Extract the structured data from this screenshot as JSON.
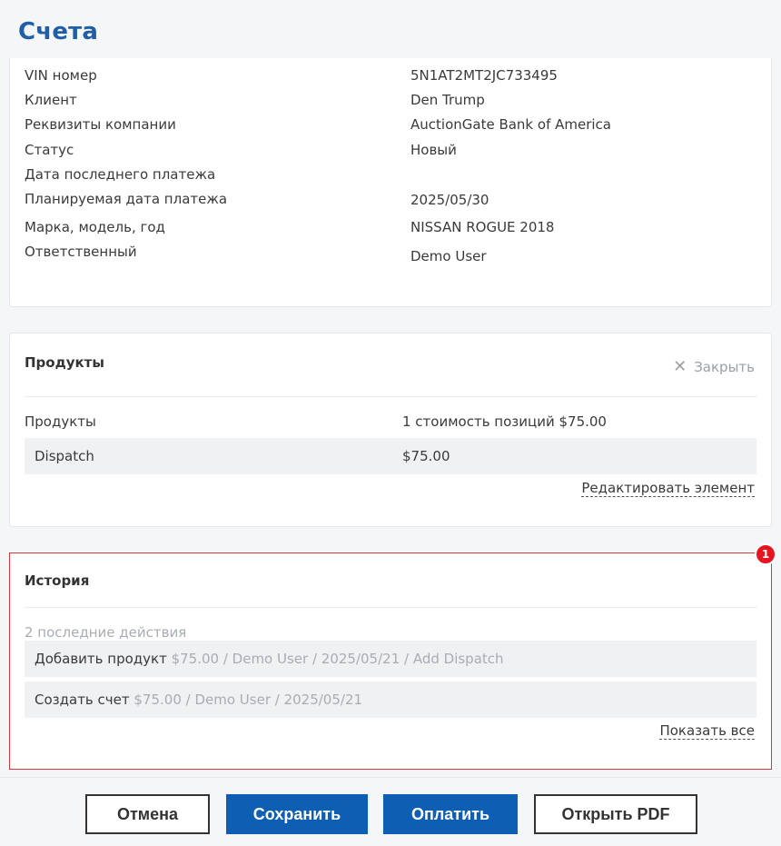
{
  "page": {
    "title": "Счета"
  },
  "details": {
    "rows": [
      {
        "label": "VIN номер",
        "value": "5N1AT2MT2JC733495"
      },
      {
        "label": "Клиент",
        "value": "Den Trump"
      },
      {
        "label": "Реквизиты компании",
        "value": "AuctionGate Bank of America"
      },
      {
        "label": "Статус",
        "value": "Новый"
      },
      {
        "label": "Дата последнего платежа",
        "value": ""
      },
      {
        "label": "Планируемая дата платежа",
        "value": "2025/05/30"
      },
      {
        "label": "Марка, модель, год",
        "value": "NISSAN ROGUE 2018"
      },
      {
        "label": "Ответственный",
        "value": "Demo User"
      }
    ]
  },
  "products": {
    "title": "Продукты",
    "close_label": "Закрыть",
    "summary": {
      "label": "Продукты",
      "value": "1 стоимость позиций $75.00"
    },
    "items": [
      {
        "name": "Dispatch",
        "price": "$75.00"
      }
    ],
    "edit_link": "Редактировать элемент"
  },
  "history": {
    "badge": "1",
    "title": "История",
    "count_text": "2 последние действия",
    "items": [
      {
        "action": "Добавить продукт",
        "meta": " $75.00 / Demo User / 2025/05/21 / Add Dispatch"
      },
      {
        "action": "Создать счет",
        "meta": " $75.00 / Demo User / 2025/05/21"
      }
    ],
    "show_all": "Показать все"
  },
  "footer": {
    "cancel": "Отмена",
    "save": "Сохранить",
    "pay": "Оплатить",
    "pdf": "Открыть PDF"
  },
  "colors": {
    "title": "#1e5fa8",
    "primary": "#0e5eb4",
    "highlight_border": "#d9363e",
    "badge": "#e8141f"
  }
}
